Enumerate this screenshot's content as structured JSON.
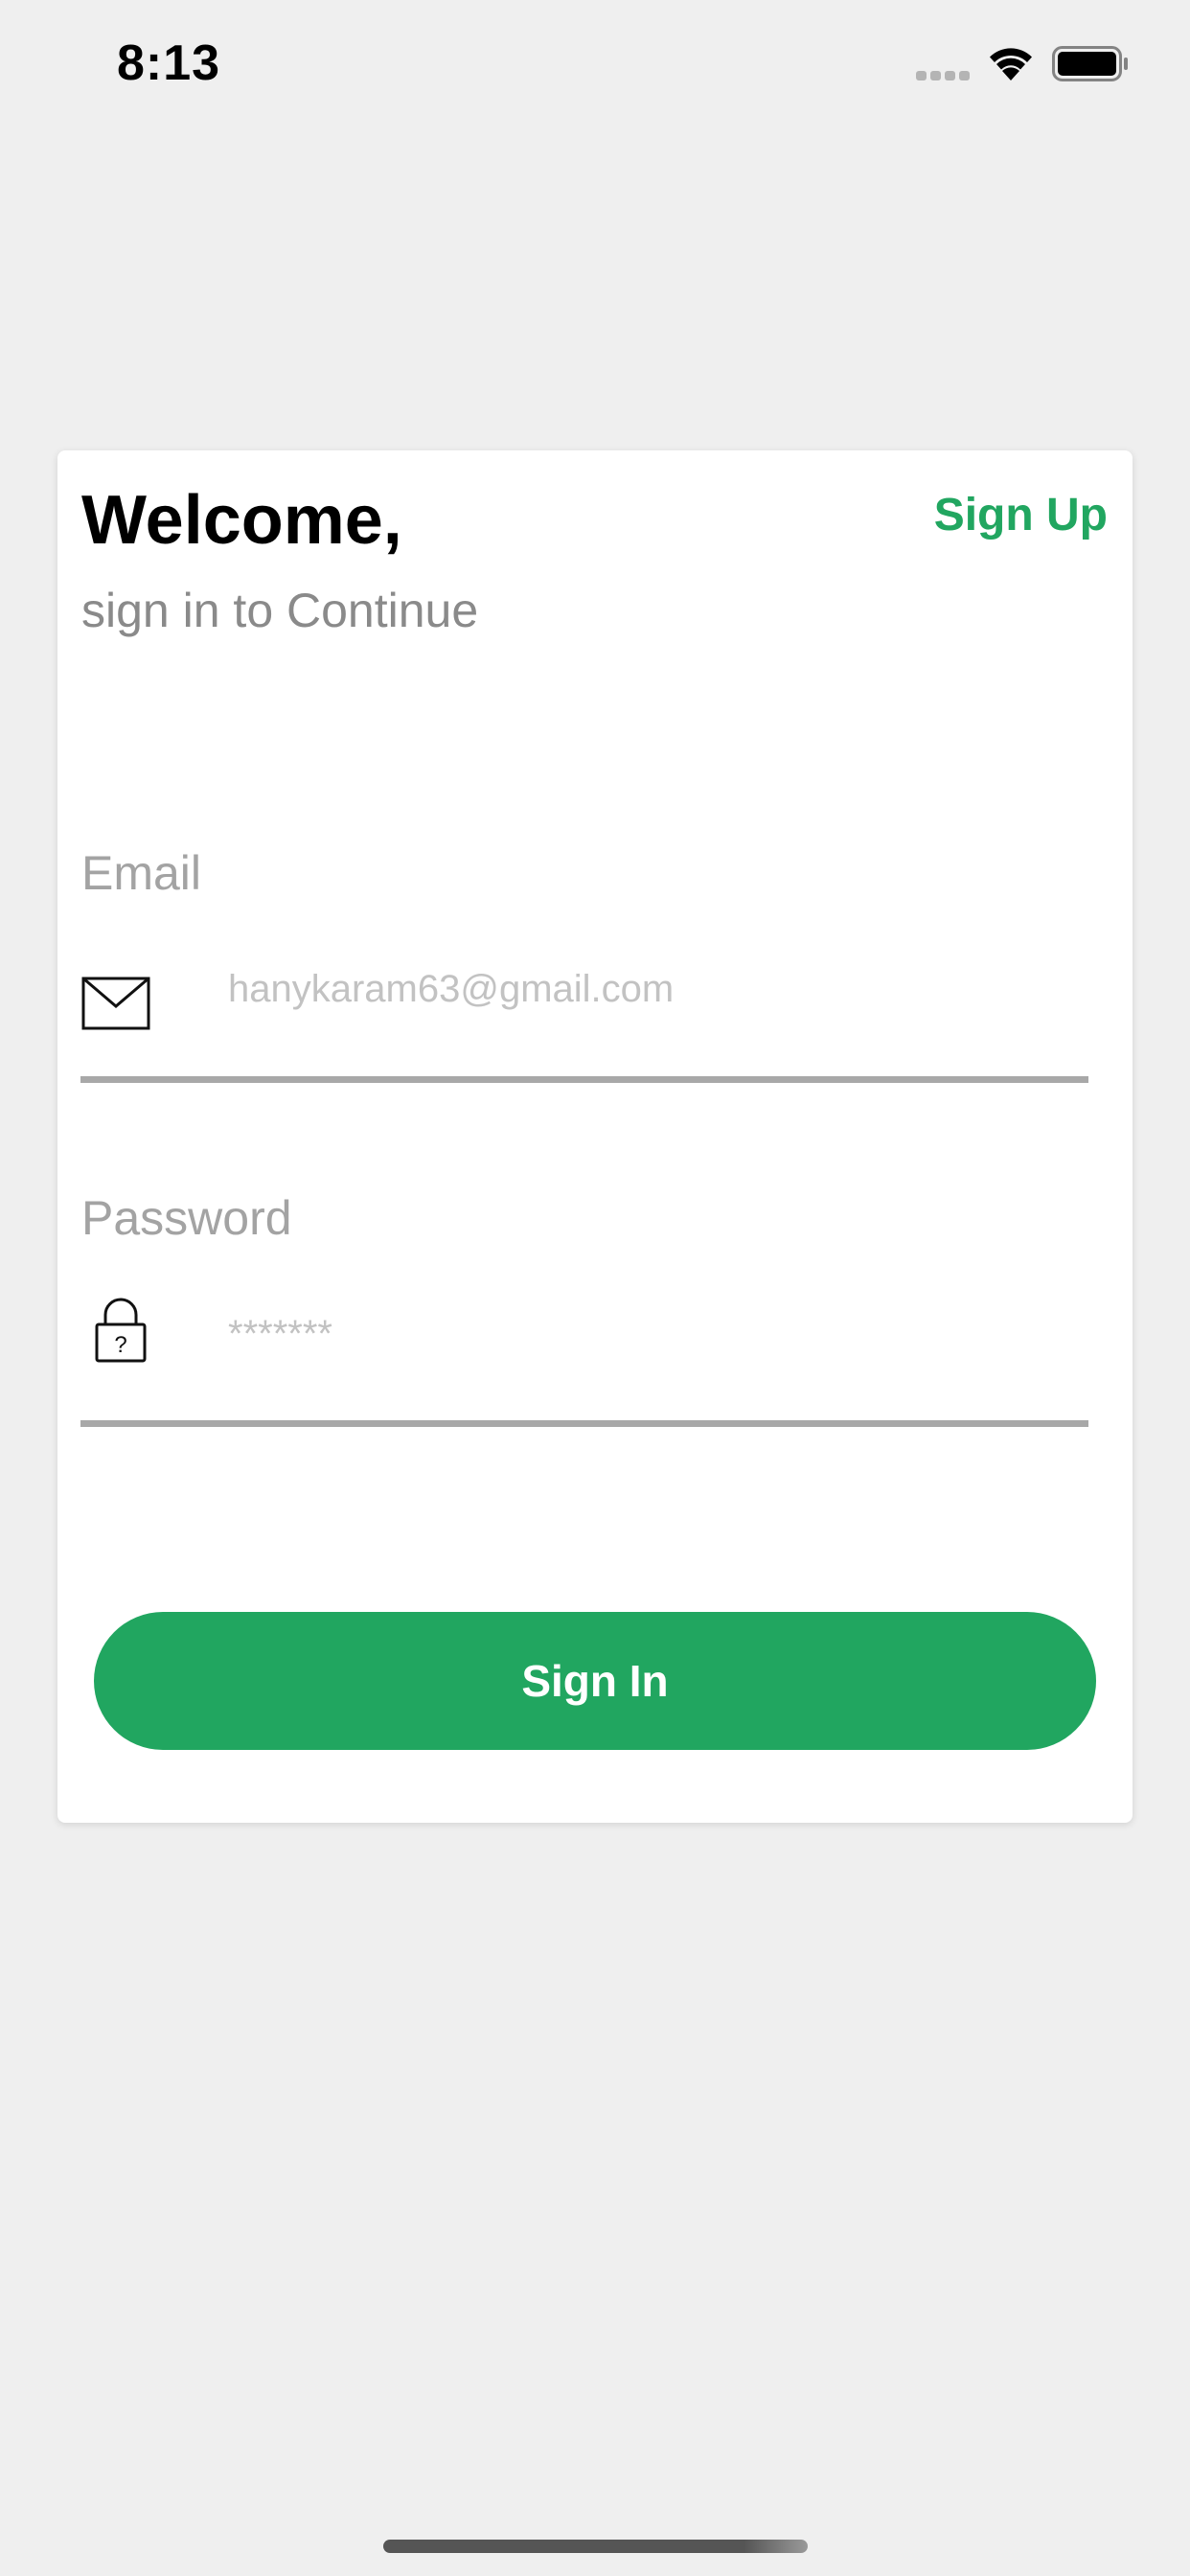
{
  "status_bar": {
    "time": "8:13",
    "signal_icon": "cellular-signal-icon",
    "wifi_icon": "wifi-icon",
    "battery_icon": "battery-icon"
  },
  "login_card": {
    "title": "Welcome,",
    "subtitle": "sign in to Continue",
    "signup_label": "Sign Up",
    "email": {
      "label": "Email",
      "icon": "envelope-icon",
      "placeholder": "hanykaram63@gmail.com"
    },
    "password": {
      "label": "Password",
      "icon": "lock-icon",
      "placeholder": "*******"
    },
    "signin_label": "Sign In"
  },
  "colors": {
    "accent": "#21a660",
    "background": "#efefef",
    "card": "#ffffff",
    "placeholder": "#c2c2c2",
    "label": "#a3a3a3"
  }
}
